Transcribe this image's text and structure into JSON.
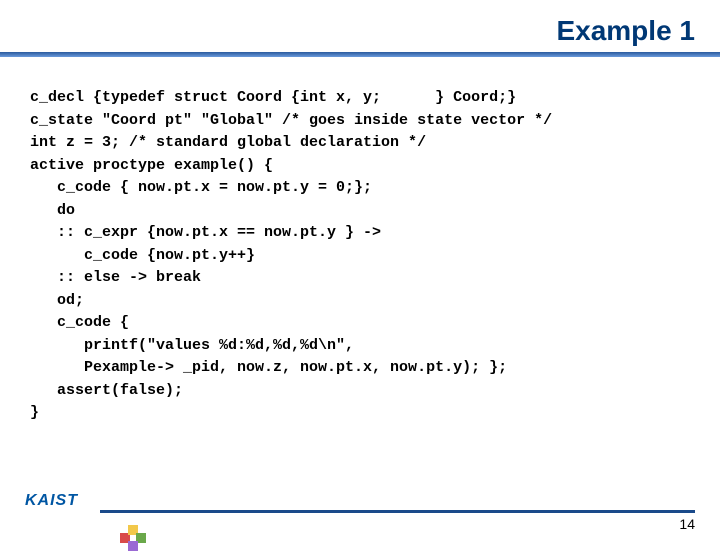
{
  "title": "Example 1",
  "code": "c_decl {typedef struct Coord {int x, y;      } Coord;}\nc_state \"Coord pt\" \"Global\" /* goes inside state vector */\nint z = 3; /* standard global declaration */\nactive proctype example() {\n   c_code { now.pt.x = now.pt.y = 0;};\n   do\n   :: c_expr {now.pt.x == now.pt.y } ->\n      c_code {now.pt.y++}\n   :: else -> break\n   od;\n   c_code {\n      printf(\"values %d:%d,%d,%d\\n\",\n      Pexample-> _pid, now.z, now.pt.x, now.pt.y); };\n   assert(false);\n}",
  "logo": "KAIST",
  "page_number": "14"
}
